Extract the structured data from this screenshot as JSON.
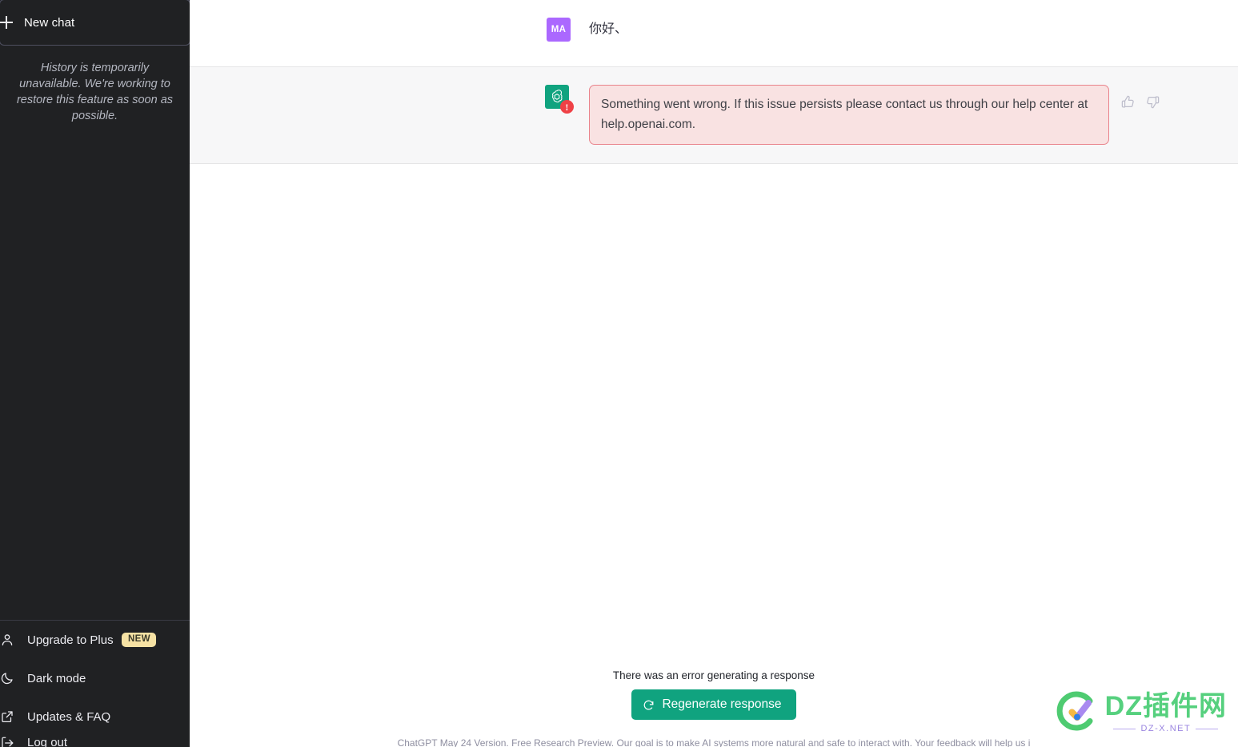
{
  "sidebar": {
    "new_chat_label": "New chat",
    "new_chat_icon": "plus-icon",
    "history_note": "History is temporarily unavailable. We're working to restore this feature as soon as possible.",
    "bottom_items": [
      {
        "label": "Upgrade to Plus",
        "icon": "person-icon",
        "badge": "NEW"
      },
      {
        "label": "Dark mode",
        "icon": "moon-icon",
        "badge": ""
      },
      {
        "label": "Updates & FAQ",
        "icon": "external-link-icon",
        "badge": ""
      },
      {
        "label": "Log out",
        "icon": "logout-icon",
        "badge": ""
      }
    ],
    "background_color": "#202123"
  },
  "conversation": {
    "messages": [
      {
        "role": "user",
        "avatar_initials": "MA",
        "avatar_color": "#ab68ff",
        "text": "你好、"
      },
      {
        "role": "assistant",
        "avatar_icon": "openai-logo-icon",
        "avatar_color": "#10a37f",
        "error_badge": "!",
        "error_text": "Something went wrong. If this issue persists please contact us through our help center at help.openai.com.",
        "error_bg": "#f9e2e2",
        "error_border": "#e9838b",
        "feedback": {
          "thumbs_up_icon": "thumbs-up-icon",
          "thumbs_down_icon": "thumbs-down-icon"
        }
      }
    ]
  },
  "footer": {
    "error_note": "There was an error generating a response",
    "regenerate_label": "Regenerate response",
    "regenerate_icon": "refresh-icon",
    "regenerate_color": "#10a37f",
    "disclaimer": "ChatGPT May 24 Version. Free Research Preview. Our goal is to make AI systems more natural and safe to interact with. Your feedback will help us i"
  },
  "watermark": {
    "main": "DZ插件网",
    "sub": "DZ-X.NET"
  }
}
